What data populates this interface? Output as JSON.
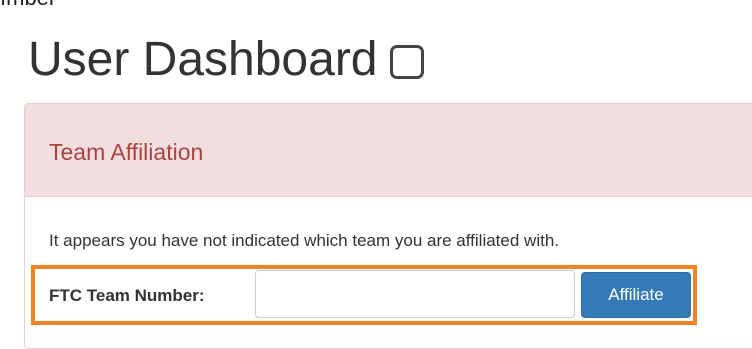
{
  "top_clip_text": "ımber",
  "page": {
    "title": "User Dashboard"
  },
  "panel": {
    "heading": "Team Affiliation",
    "notice": "It appears you have not indicated which team you are affiliated with.",
    "form": {
      "label": "FTC Team Number:",
      "input_value": "",
      "input_placeholder": "",
      "button_label": "Affiliate"
    }
  },
  "colors": {
    "panel_heading_bg": "#f2dede",
    "panel_heading_text": "#a94442",
    "button_bg": "#337ab7",
    "highlight_border": "#f08326"
  }
}
